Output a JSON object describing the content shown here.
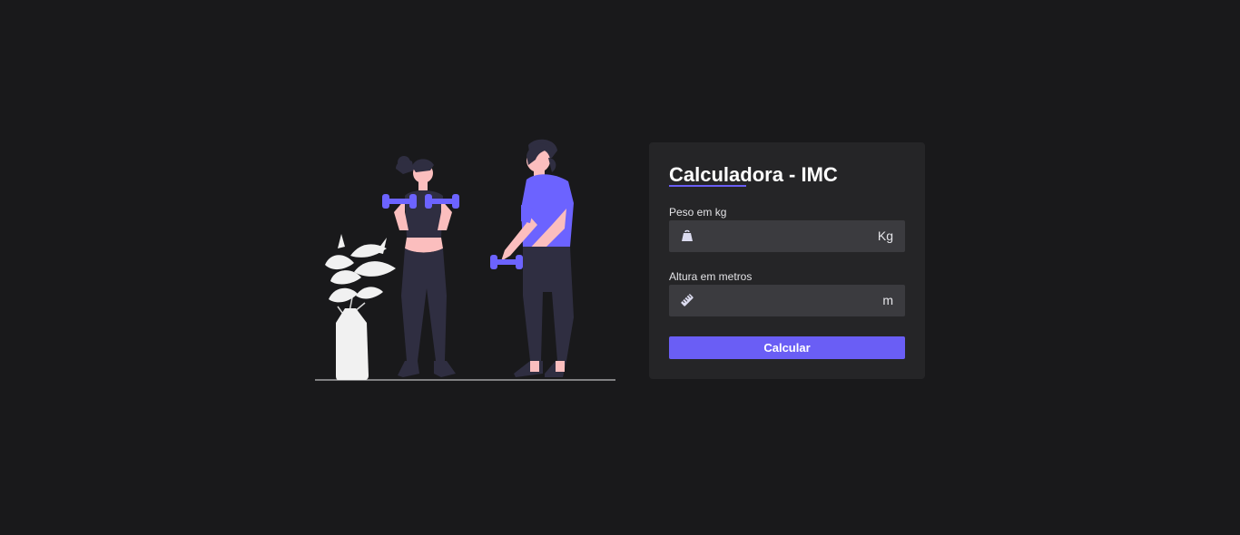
{
  "form": {
    "title": "Calculadora - IMC",
    "weight": {
      "label": "Peso em kg",
      "value": "",
      "placeholder": "",
      "unit": "Kg",
      "icon": "weight-icon"
    },
    "height": {
      "label": "Altura em metros",
      "value": "",
      "placeholder": "",
      "unit": "m",
      "icon": "ruler-icon"
    },
    "submit_label": "Calcular"
  },
  "colors": {
    "background": "#19191b",
    "card": "#252527",
    "input": "#3b3b3f",
    "accent": "#6a5ef5"
  }
}
